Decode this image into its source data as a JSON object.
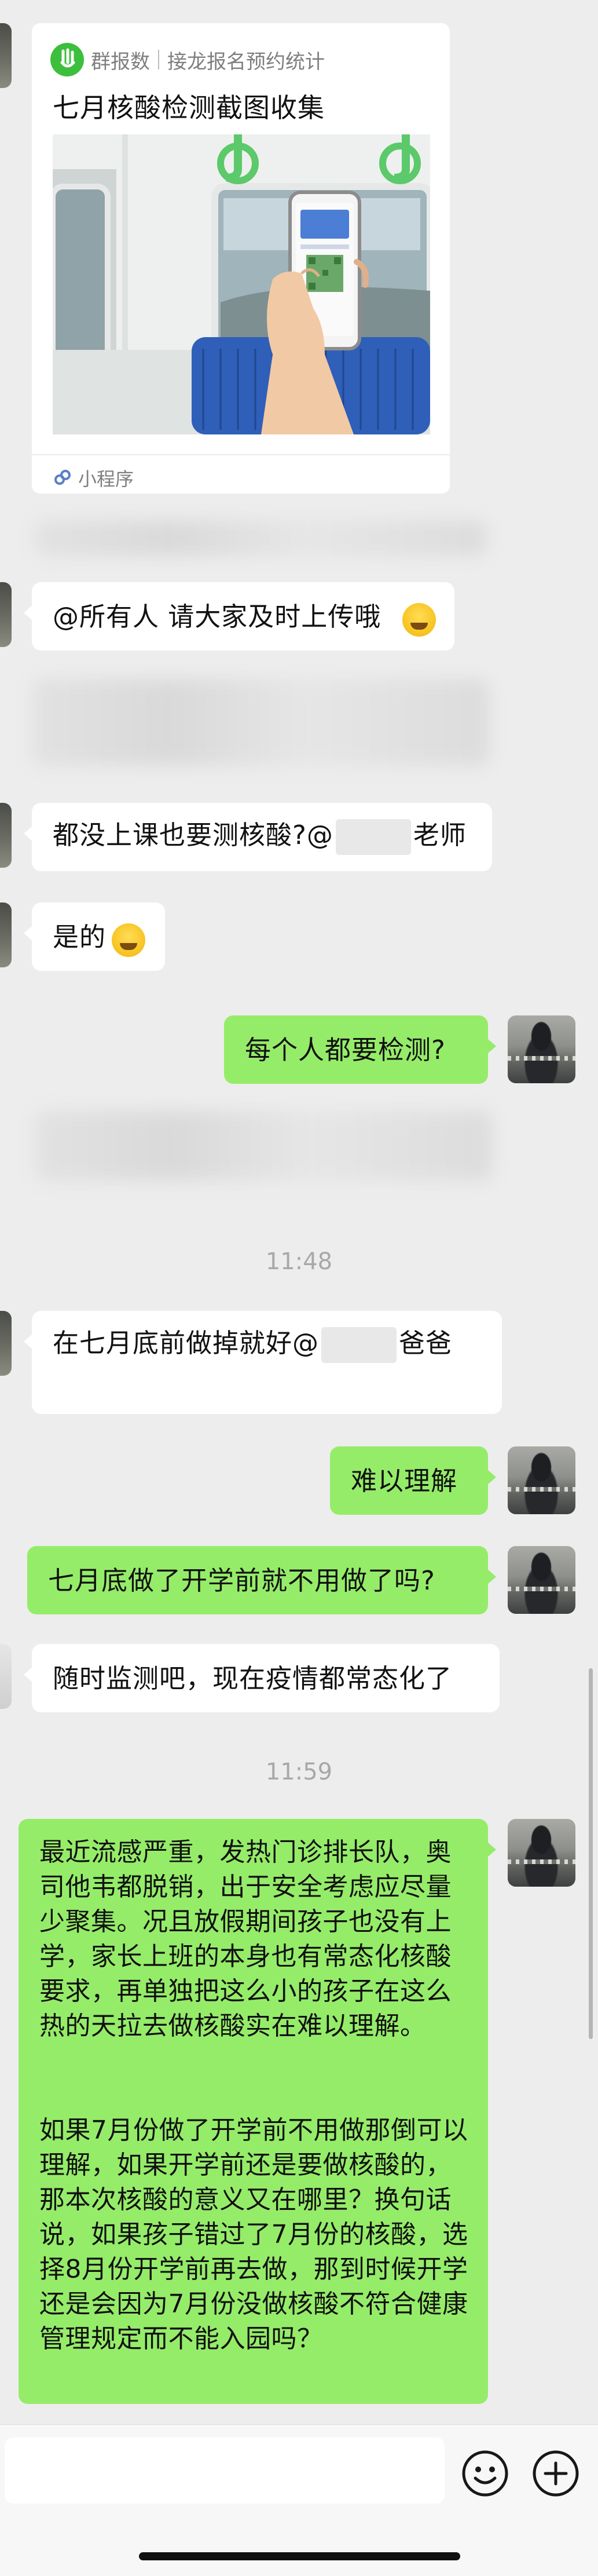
{
  "card": {
    "source_name": "群报数",
    "source_subtitle": "接龙报名预约统计",
    "title": "七月核酸检测截图收集",
    "footer_label": "小程序"
  },
  "messages": {
    "m1_text": "@所有人 请大家及时上传哦",
    "m2_before": "都没上课也要测核酸?@",
    "m2_after": "老师",
    "m3_text": "是的",
    "m4_text": "每个人都要检测?",
    "time1": "11:48",
    "m5_before": "在七月底前做掉就好@",
    "m5_after": "爸爸",
    "m6_text": "难以理解",
    "m7_text": "七月底做了开学前就不用做了吗?",
    "m8_text": "随时监测吧，现在疫情都常态化了",
    "time2": "11:59",
    "m9_para1": "最近流感严重，发热门诊排长队，奥司他韦都脱销，出于安全考虑应尽量少聚集。况且放假期间孩子也没有上学，家长上班的本身也有常态化核酸要求，再单独把这么小的孩子在这么热的天拉去做核酸实在难以理解。",
    "m9_para2": "如果7月份做了开学前不用做那倒可以理解，如果开学前还是要做核酸的，那本次核酸的意义又在哪里？换句话说，如果孩子错过了7月份的核酸，选择8月份开学前再去做，那到时候开学还是会因为7月份没做核酸不符合健康管理规定而不能入园吗？"
  },
  "input_bar": {
    "input_value": "",
    "emoji_icon": "smiley-icon",
    "plus_icon": "plus-circle-icon"
  },
  "colors": {
    "background": "#ededed",
    "self_bubble": "#95ec69",
    "other_bubble": "#ffffff",
    "time_text": "#a8a8a8"
  }
}
